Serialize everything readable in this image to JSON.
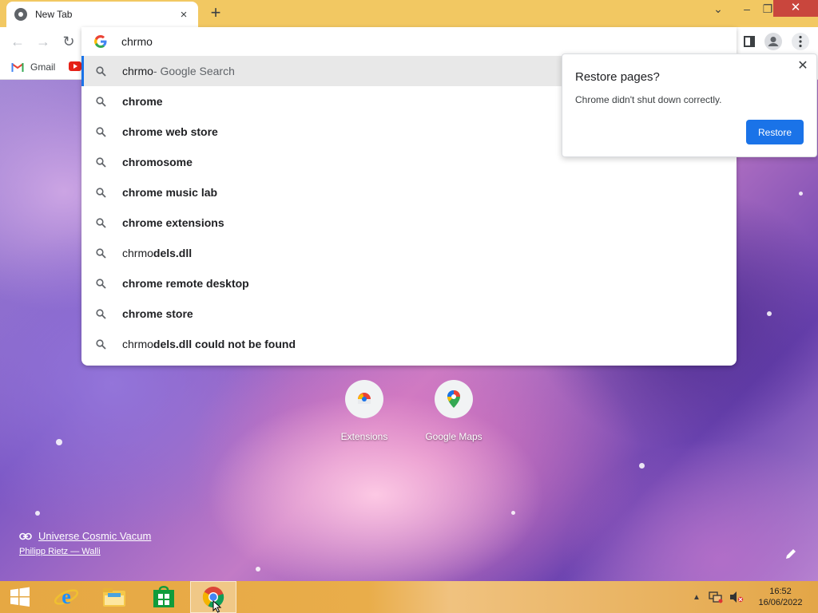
{
  "browser": {
    "tab_title": "New Tab",
    "tab_close": "×",
    "new_tab": "+",
    "window": {
      "minimize": "–",
      "maximize": "❐",
      "close": "✕",
      "tab_search": "⌄"
    }
  },
  "toolbar": {
    "back": "←",
    "forward": "→",
    "reload": "↻"
  },
  "bookmarks": [
    {
      "label": "Gmail",
      "icon": "gmail-icon"
    },
    {
      "label": "",
      "icon": "youtube-icon"
    }
  ],
  "omnibox": {
    "value": "chrmo",
    "suggestions": [
      {
        "typed": "chrmo",
        "rest": "",
        "desc": " - Google Search",
        "selected": true
      },
      {
        "typed": "",
        "rest": "chrome",
        "desc": ""
      },
      {
        "typed": "",
        "rest": "chrome web store",
        "desc": ""
      },
      {
        "typed": "",
        "rest": "chromosome",
        "desc": ""
      },
      {
        "typed": "",
        "rest": "chrome music lab",
        "desc": ""
      },
      {
        "typed": "",
        "rest": "chrome extensions",
        "desc": ""
      },
      {
        "typed": "chrmo",
        "rest": "dels.dll",
        "desc": ""
      },
      {
        "typed": "",
        "rest": "chrome remote desktop",
        "desc": ""
      },
      {
        "typed": "",
        "rest": "chrome store",
        "desc": ""
      },
      {
        "typed": "chrmo",
        "rest": "dels.dll could not be found",
        "desc": ""
      }
    ]
  },
  "restore_bubble": {
    "title": "Restore pages?",
    "message": "Chrome didn't shut down correctly.",
    "button": "Restore",
    "close": "✕",
    "accent": "#1a73e8"
  },
  "shortcuts": [
    {
      "label": "Extensions",
      "icon": "chrome-web-store-icon"
    },
    {
      "label": "Google Maps",
      "icon": "google-maps-icon"
    }
  ],
  "attribution": {
    "title": "Universe Cosmic Vacum",
    "author": "Philipp Rietz — Walli"
  },
  "taskbar": {
    "apps": [
      "windows-start-icon",
      "internet-explorer-icon",
      "file-explorer-icon",
      "windows-store-icon",
      "chrome-icon"
    ],
    "tray_chevron": "▲",
    "time": "16:52",
    "date": "16/06/2022"
  }
}
